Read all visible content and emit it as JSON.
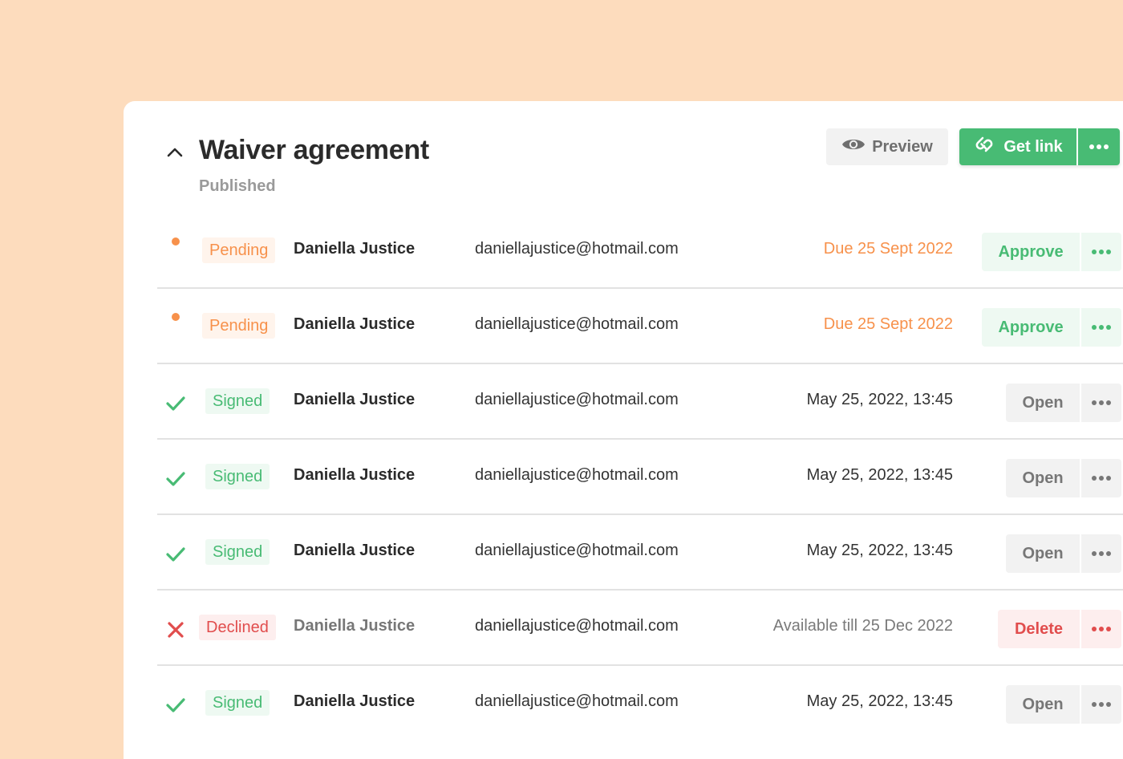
{
  "header": {
    "title": "Waiver agreement",
    "subtitle": "Published",
    "preview_label": "Preview",
    "get_link_label": "Get link"
  },
  "colors": {
    "background": "#fddcbd",
    "green": "#48bb74",
    "orange": "#f7914b",
    "red": "#e14d4d",
    "gray": "#777777"
  },
  "rows": [
    {
      "status": "pending",
      "status_label": "Pending",
      "name": "Daniella Justice",
      "email": "daniellajustice@hotmail.com",
      "date": "Due 25 Sept 2022",
      "action": "Approve"
    },
    {
      "status": "pending",
      "status_label": "Pending",
      "name": "Daniella Justice",
      "email": "daniellajustice@hotmail.com",
      "date": "Due 25 Sept 2022",
      "action": "Approve"
    },
    {
      "status": "signed",
      "status_label": "Signed",
      "name": "Daniella Justice",
      "email": "daniellajustice@hotmail.com",
      "date": "May 25, 2022, 13:45",
      "action": "Open"
    },
    {
      "status": "signed",
      "status_label": "Signed",
      "name": "Daniella Justice",
      "email": "daniellajustice@hotmail.com",
      "date": "May 25, 2022, 13:45",
      "action": "Open"
    },
    {
      "status": "signed",
      "status_label": "Signed",
      "name": "Daniella Justice",
      "email": "daniellajustice@hotmail.com",
      "date": "May 25, 2022, 13:45",
      "action": "Open"
    },
    {
      "status": "declined",
      "status_label": "Declined",
      "name": "Daniella Justice",
      "email": "daniellajustice@hotmail.com",
      "date": "Available till 25 Dec 2022",
      "action": "Delete"
    },
    {
      "status": "signed",
      "status_label": "Signed",
      "name": "Daniella Justice",
      "email": "daniellajustice@hotmail.com",
      "date": "May 25, 2022, 13:45",
      "action": "Open"
    }
  ]
}
